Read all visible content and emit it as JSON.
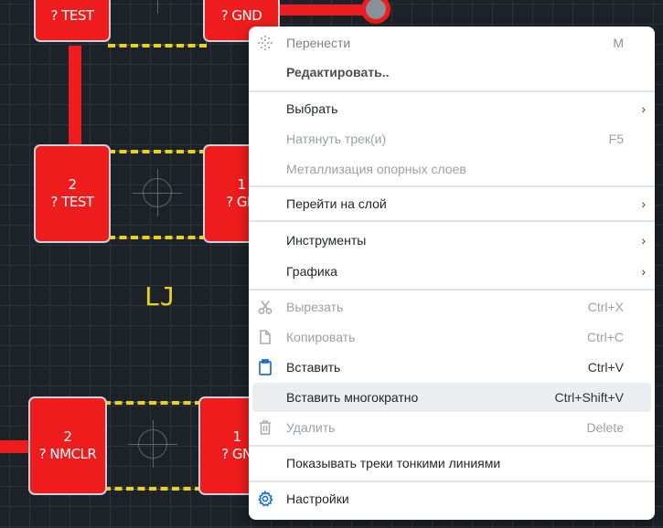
{
  "pcb": {
    "pads": [
      {
        "num": "",
        "net": "? TEST"
      },
      {
        "num": "",
        "net": "? GND"
      },
      {
        "num": "2",
        "net": "? TEST"
      },
      {
        "num": "1",
        "net": "? GN"
      },
      {
        "num": "2",
        "net": "? NMCLR"
      },
      {
        "num": "1",
        "net": "? GN"
      }
    ],
    "refdes": "LJ"
  },
  "context_menu": {
    "items": [
      {
        "label": "Перенести",
        "shortcut": "M",
        "icon": "move-icon",
        "disabled": false
      },
      {
        "label": "Редактировать..",
        "shortcut": "",
        "bold": true
      },
      {
        "label": "Выбрать",
        "submenu": true
      },
      {
        "label": "Натянуть трек(и)",
        "shortcut": "F5",
        "disabled": true
      },
      {
        "label": "Металлизация опорных слоев",
        "disabled": true
      },
      {
        "label": "Перейти на слой",
        "submenu": true
      },
      {
        "label": "Инструменты",
        "submenu": true
      },
      {
        "label": "Графика",
        "submenu": true
      },
      {
        "label": "Вырезать",
        "shortcut": "Ctrl+X",
        "icon": "scissors-icon",
        "disabled": true
      },
      {
        "label": "Копировать",
        "shortcut": "Ctrl+C",
        "icon": "copy-icon",
        "disabled": true
      },
      {
        "label": "Вставить",
        "shortcut": "Ctrl+V",
        "icon": "clipboard-icon",
        "disabled": false
      },
      {
        "label": "Вставить многократно",
        "shortcut": "Ctrl+Shift+V",
        "hovered": true
      },
      {
        "label": "Удалить",
        "shortcut": "Delete",
        "icon": "trash-icon",
        "disabled": true
      },
      {
        "label": "Показывать треки тонкими линиями"
      },
      {
        "label": "Настройки",
        "icon": "gear-icon"
      }
    ],
    "submenu_arrow": "›",
    "colors": {
      "icon_blue": "#1a6fd1",
      "disabled": "#9aa0a6",
      "hover": "#ebedee"
    }
  }
}
